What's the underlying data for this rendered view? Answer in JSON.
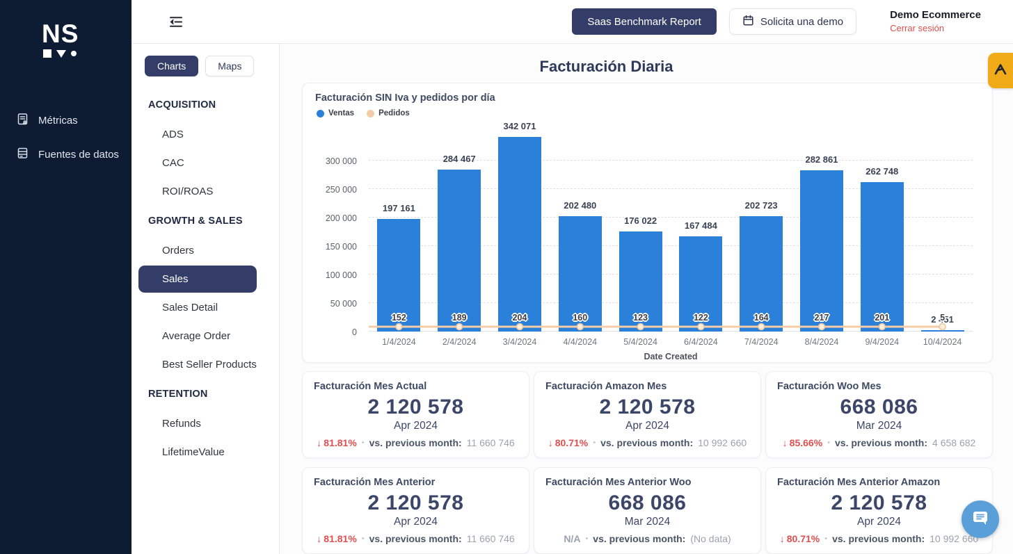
{
  "colors": {
    "sidebar_bg": "#0e1c33",
    "accent_navy": "#333d68",
    "bar_blue": "#2b80d9",
    "line_peach": "#f4cda6",
    "red": "#e04f4f",
    "tab_orange": "#f2ab18",
    "chat_blue": "#5b9fd8"
  },
  "brand": {
    "logo_text": "NS"
  },
  "sidebar": {
    "items": [
      {
        "label": "Métricas",
        "icon": "metrics-report-icon"
      },
      {
        "label": "Fuentes de datos",
        "icon": "data-sources-icon"
      }
    ]
  },
  "header": {
    "benchmark_button": "Saas Benchmark Report",
    "demo_button": "Solicita una demo",
    "account_name": "Demo Ecommerce",
    "logout_link": "Cerrar sesión"
  },
  "subnav": {
    "view_buttons": [
      {
        "label": "Charts",
        "active": true
      },
      {
        "label": "Maps",
        "active": false
      }
    ],
    "sections": [
      {
        "header": "ACQUISITION",
        "items": [
          {
            "label": "ADS"
          },
          {
            "label": "CAC"
          },
          {
            "label": "ROI/ROAS"
          }
        ]
      },
      {
        "header": "GROWTH & SALES",
        "items": [
          {
            "label": "Orders"
          },
          {
            "label": "Sales",
            "active": true
          },
          {
            "label": "Sales Detail"
          },
          {
            "label": "Average Order"
          },
          {
            "label": "Best Seller Products"
          }
        ]
      },
      {
        "header": "RETENTION",
        "items": [
          {
            "label": "Refunds"
          },
          {
            "label": "LifetimeValue"
          }
        ]
      }
    ]
  },
  "page": {
    "title": "Facturación Diaria"
  },
  "chart_data": {
    "type": "bar",
    "title": "Facturación SIN Iva y pedidos por día",
    "xlabel": "Date Created",
    "categories": [
      "1/4/2024",
      "2/4/2024",
      "3/4/2024",
      "4/4/2024",
      "5/4/2024",
      "6/4/2024",
      "7/4/2024",
      "8/4/2024",
      "9/4/2024",
      "10/4/2024"
    ],
    "series": [
      {
        "name": "Ventas",
        "type": "bar",
        "color": "#2b80d9",
        "values": [
          197161,
          284467,
          342071,
          202480,
          176022,
          167484,
          202723,
          282861,
          262748,
          2451
        ],
        "labels": [
          "197 161",
          "284 467",
          "342 071",
          "202 480",
          "176 022",
          "167 484",
          "202 723",
          "282 861",
          "262 748",
          "2 451"
        ]
      },
      {
        "name": "Pedidos",
        "type": "line",
        "color": "#f4cda6",
        "marker_fill": "#fdeede",
        "values": [
          152,
          189,
          204,
          160,
          123,
          122,
          164,
          217,
          201,
          5
        ],
        "labels": [
          "152",
          "189",
          "204",
          "160",
          "123",
          "122",
          "164",
          "217",
          "201",
          "5"
        ]
      }
    ],
    "ylim": [
      0,
      300000
    ],
    "ytick_values": [
      0,
      50000,
      100000,
      150000,
      200000,
      250000,
      300000
    ],
    "ytick_labels": [
      "0",
      "50 000",
      "100 000",
      "150 000",
      "200 000",
      "250 000",
      "300 000"
    ],
    "grid": "dashed-horizontal",
    "legend_position": "top-left"
  },
  "cards": [
    {
      "title": "Facturación Mes Actual",
      "value": "2 120 578",
      "month": "Apr 2024",
      "delta": "81.81%",
      "delta_dir": "down",
      "sep": "•",
      "vs_label": "vs. previous month:",
      "vs_value": "11 660 746"
    },
    {
      "title": "Facturación Amazon Mes",
      "value": "2 120 578",
      "month": "Apr 2024",
      "delta": "80.71%",
      "delta_dir": "down",
      "sep": "•",
      "vs_label": "vs. previous month:",
      "vs_value": "10 992 660"
    },
    {
      "title": "Facturación Woo Mes",
      "value": "668 086",
      "month": "Mar 2024",
      "delta": "85.66%",
      "delta_dir": "down",
      "sep": "•",
      "vs_label": "vs. previous month:",
      "vs_value": "4 658 682"
    },
    {
      "title": "Facturación Mes Anterior",
      "value": "2 120 578",
      "month": "Apr 2024",
      "delta": "81.81%",
      "delta_dir": "down",
      "sep": "•",
      "vs_label": "vs. previous month:",
      "vs_value": "11 660 746"
    },
    {
      "title": "Facturación Mes Anterior Woo",
      "value": "668 086",
      "month": "Mar 2024",
      "delta": "N/A",
      "delta_dir": "none",
      "sep": "•",
      "vs_label": "vs. previous month:",
      "vs_value": "(No data)"
    },
    {
      "title": "Facturación Mes Anterior Amazon",
      "value": "2 120 578",
      "month": "Apr 2024",
      "delta": "80.71%",
      "delta_dir": "down",
      "sep": "•",
      "vs_label": "vs. previous month:",
      "vs_value": "10 992 660"
    }
  ]
}
